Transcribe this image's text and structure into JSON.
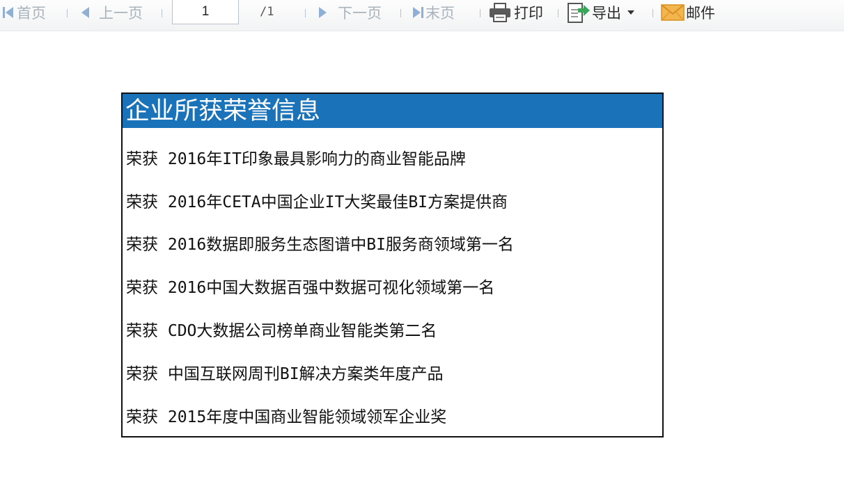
{
  "toolbar": {
    "first_label": "首页",
    "prev_label": "上一页",
    "page_value": "1",
    "page_total": "/1",
    "next_label": "下一页",
    "last_label": "末页",
    "print_label": "打印",
    "export_label": "导出",
    "mail_label": "邮件"
  },
  "panel": {
    "title": "企业所获荣誉信息",
    "items": [
      "荣获 2016年IT印象最具影响力的商业智能品牌",
      "荣获 2016年CETA中国企业IT大奖最佳BI方案提供商",
      "荣获 2016数据即服务生态图谱中BI服务商领域第一名",
      "荣获 2016中国大数据百强中数据可视化领域第一名",
      "荣获 CDO大数据公司榜单商业智能类第二名",
      "荣获 中国互联网周刊BI解决方案类年度产品",
      "荣获 2015年度中国商业智能领域领军企业奖"
    ]
  },
  "colors": {
    "header_bg": "#1a72b8",
    "nav_disabled": "#a9b3bc",
    "nav_icon": "#8fb0d4",
    "mail_icon": "#f0a83a",
    "export_arrow": "#39a65a"
  },
  "icons": [
    "first-page-icon",
    "prev-page-icon",
    "next-page-icon",
    "last-page-icon",
    "printer-icon",
    "export-icon",
    "dropdown-caret-icon",
    "mail-icon"
  ]
}
